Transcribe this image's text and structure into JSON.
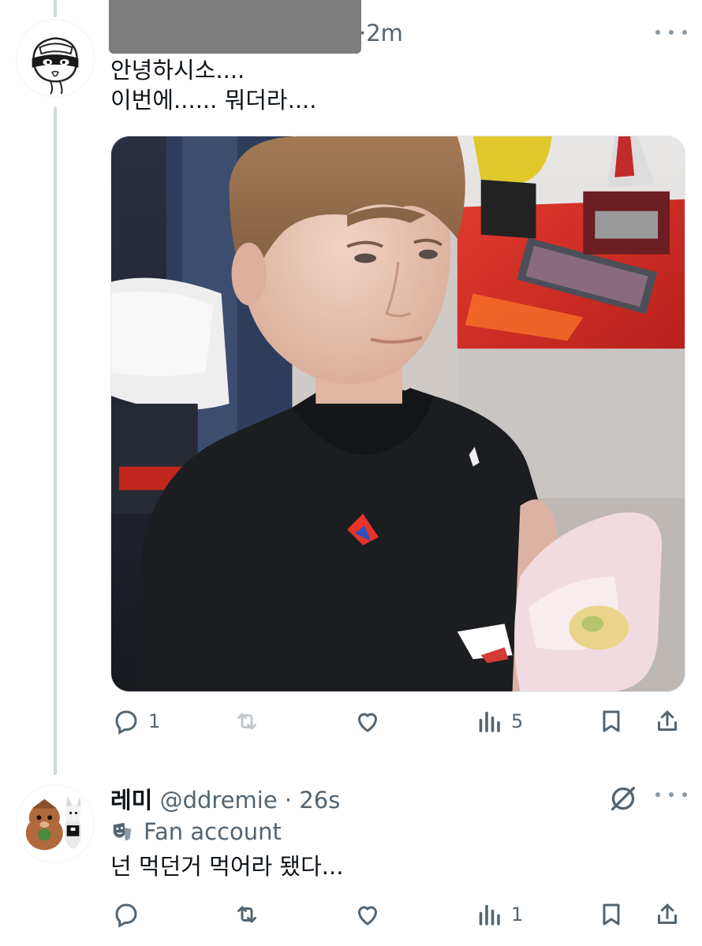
{
  "tweet1": {
    "time": "·2m",
    "text": "안녕하시소....\n이번에...... 뭐더라....",
    "photo_description": "Photo of a young man in a black t-shirt holding a wrapped sandwich",
    "actions": {
      "reply_count": "1",
      "retweet_count": "",
      "like_count": "",
      "views_count": "5"
    }
  },
  "tweet2": {
    "display_name": "레미",
    "handle_time": "@ddremie · 26s",
    "label": "Fan account",
    "text": "넌 먹던거 먹어라 됐다...",
    "actions": {
      "reply_count": "",
      "retweet_count": "",
      "like_count": "",
      "views_count": "1"
    }
  },
  "icons": {
    "reply": "reply-icon",
    "retweet": "retweet-icon",
    "like": "heart-icon",
    "views": "views-icon",
    "bookmark": "bookmark-icon",
    "share": "share-icon",
    "more": "more-icon"
  },
  "colors": {
    "text_primary": "#0f1419",
    "text_secondary": "#536471",
    "thread_line": "#cfd9de"
  }
}
